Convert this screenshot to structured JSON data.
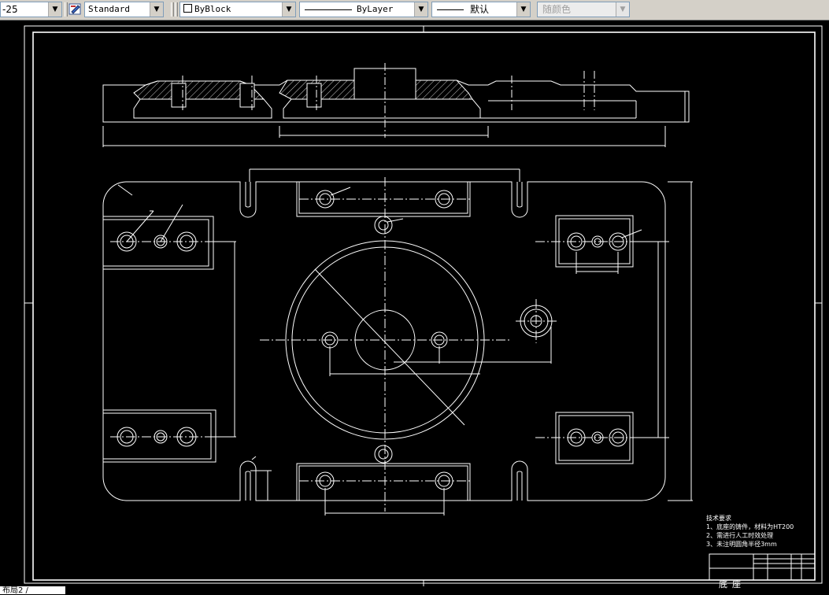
{
  "toolbar": {
    "dimstyle_value": "-25",
    "textstyle_value": "Standard",
    "color_value": "ByBlock",
    "linetype_value": "ByLayer",
    "lineweight_value": "默认",
    "plotstyle_value": "随颜色"
  },
  "drawing": {
    "tech_requirements": {
      "heading": "技术要求",
      "items": [
        "1、底座的铸件，材料为HT200",
        "2、需进行人工时效处理",
        "3、未注明圆角半径3mm"
      ]
    },
    "title_block": {
      "part_name": "底座"
    }
  },
  "status": {
    "layout_tab": "布局2 /"
  },
  "colors": {
    "background": "#000000",
    "lines": "#ffffff",
    "toolbar": "#d4d0c8"
  }
}
